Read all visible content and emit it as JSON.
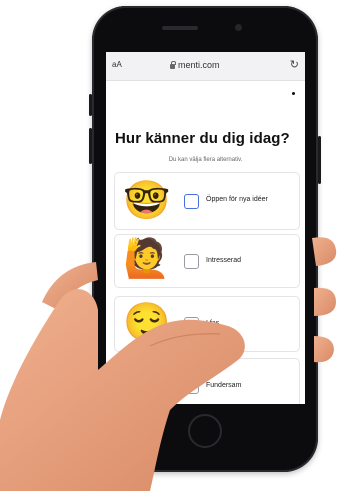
{
  "browser": {
    "text_size_label": "aA",
    "url": "menti.com",
    "reload_icon": "reload-icon"
  },
  "poll": {
    "question": "Hur känner du dig idag?",
    "subtitle": "Du kan välja flera alternativ.",
    "options": [
      {
        "label": "Öppen för nya idéer",
        "emoji": "🤓",
        "checked": false
      },
      {
        "label": "Intresserad",
        "emoji": "🙋",
        "checked": false
      },
      {
        "label": "I fas",
        "emoji": "😌",
        "checked": false
      },
      {
        "label": "Fundersam",
        "emoji": "🤔",
        "checked": false
      }
    ]
  },
  "colors": {
    "phone_body": "#0c0c0e",
    "checkbox_active": "#4a6fd8",
    "skin": "#e8a07e"
  }
}
